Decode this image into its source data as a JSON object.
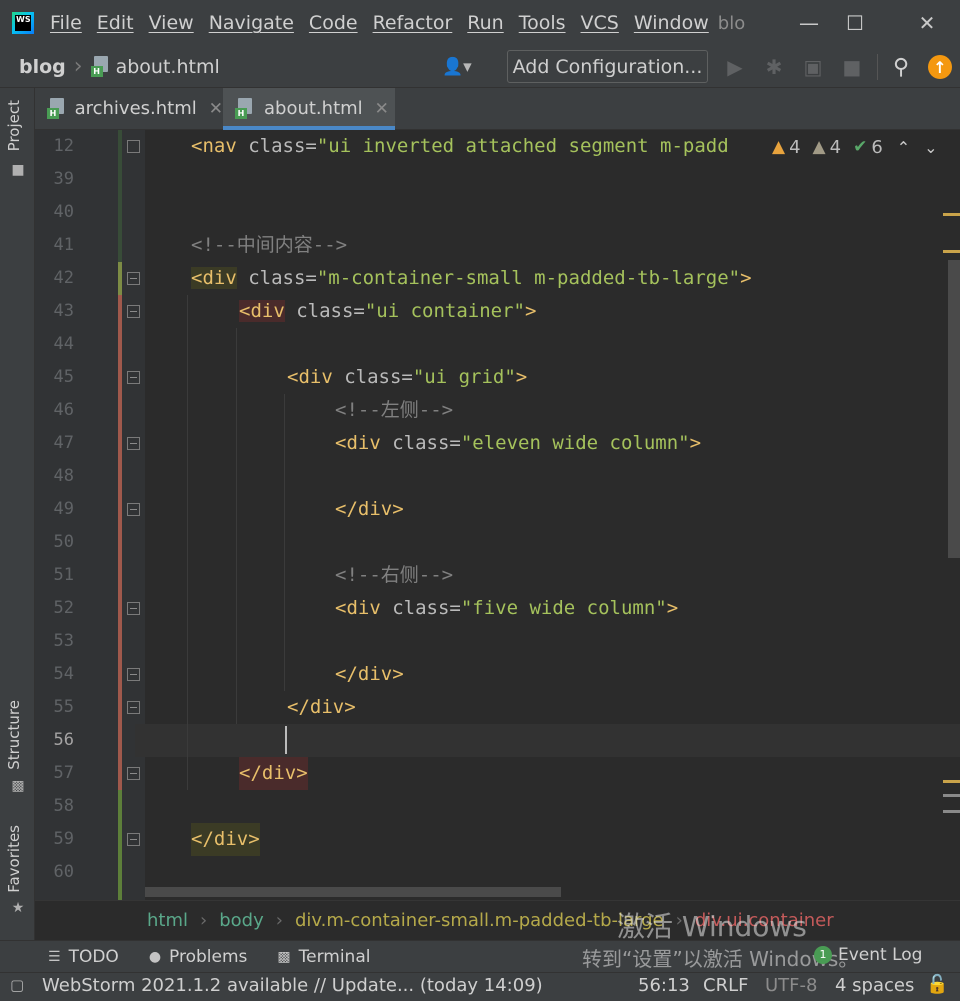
{
  "menubar": {
    "items": [
      "File",
      "Edit",
      "View",
      "Navigate",
      "Code",
      "Refactor",
      "Run",
      "Tools",
      "VCS",
      "Window"
    ],
    "window_title": "blo",
    "logo_text": "WS",
    "controls": {
      "minimize": "—",
      "maximize": "☐",
      "close": "✕"
    }
  },
  "navbar": {
    "project": "blog",
    "file": "about.html",
    "add_configuration": "Add Configuration..."
  },
  "left_strip": {
    "project": "Project",
    "structure": "Structure",
    "favorites": "Favorites"
  },
  "tabs": [
    {
      "label": "archives.html",
      "active": false
    },
    {
      "label": "about.html",
      "active": true
    }
  ],
  "inspections": {
    "warnings": "4",
    "weak_warnings": "4",
    "ok": "6"
  },
  "editor": {
    "lines": [
      {
        "num": "12",
        "tag": "<nav",
        "attr": " class=",
        "val": "\"ui inverted attached segment m-padd",
        "close": ""
      },
      {
        "num": "39"
      },
      {
        "num": "40"
      },
      {
        "num": "41",
        "comment": "<!--中间内容-->"
      },
      {
        "num": "42",
        "tag": "<div",
        "attr": " class=",
        "val": "\"m-container-small m-padded-tb-large\"",
        "close": ">"
      },
      {
        "num": "43",
        "tag": "<div",
        "attr": " class=",
        "val": "\"ui container\"",
        "close": ">"
      },
      {
        "num": "44"
      },
      {
        "num": "45",
        "tag": "<div",
        "attr": " class=",
        "val": "\"ui grid\"",
        "close": ">"
      },
      {
        "num": "46",
        "comment": "<!--左侧-->"
      },
      {
        "num": "47",
        "tag": "<div",
        "attr": " class=",
        "val": "\"eleven wide column\"",
        "close": ">"
      },
      {
        "num": "48"
      },
      {
        "num": "49",
        "tag": "</div>"
      },
      {
        "num": "50"
      },
      {
        "num": "51",
        "comment": "<!--右侧-->"
      },
      {
        "num": "52",
        "tag": "<div",
        "attr": " class=",
        "val": "\"five wide column\"",
        "close": ">"
      },
      {
        "num": "53"
      },
      {
        "num": "54",
        "tag": "</div>"
      },
      {
        "num": "55",
        "tag": "</div>"
      },
      {
        "num": "56"
      },
      {
        "num": "57",
        "tag": "</div>"
      },
      {
        "num": "58"
      },
      {
        "num": "59",
        "tag": "</div>"
      },
      {
        "num": "60"
      }
    ],
    "current_line": "56"
  },
  "breadcrumbs": [
    "html",
    "body",
    "div.m-container-small.m-padded-tb-large",
    "div.ui.container"
  ],
  "tool_windows": {
    "todo": "TODO",
    "problems": "Problems",
    "terminal": "Terminal",
    "event_log": "Event Log",
    "event_count": "1"
  },
  "status": {
    "message": "WebStorm 2021.1.2 available // Update... (today 14:09)",
    "position": "56:13",
    "line_separator": "CRLF",
    "encoding": "UTF-8",
    "indent": "4 spaces"
  },
  "watermark": {
    "line1": "激活 Windows",
    "line2": "转到“设置”以激活 Windows。"
  },
  "colors": {
    "accent": "#4a88c7",
    "tag": "#e8bf6a",
    "string": "#a5c25c",
    "comment": "#808080",
    "warning": "#e8a33d",
    "update": "#f49810"
  }
}
